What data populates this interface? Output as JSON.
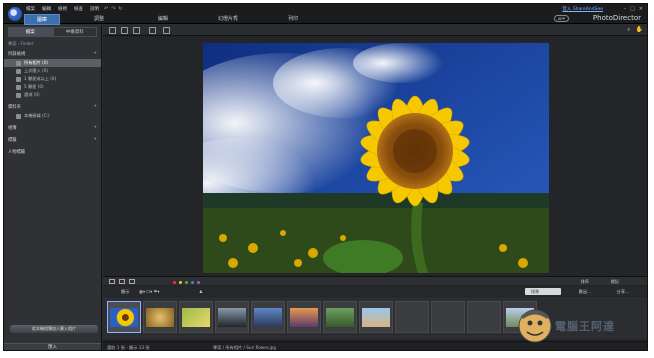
{
  "topbar": {
    "menu": [
      "檔案",
      "編輯",
      "檢視",
      "檢查",
      "說明"
    ],
    "main_tabs": [
      "圖庫",
      "調整",
      "編輯",
      "幻燈片秀",
      "列印"
    ],
    "sign_in": "登入 ShareAndSee",
    "app_badge": "APP",
    "brand": "PhotoDirector"
  },
  "left_panel": {
    "tabs": [
      "檔案",
      "中繼資料"
    ],
    "breadcrumb": "專案 - Finder",
    "section_library": "目錄檢視",
    "library_items": [
      {
        "label": "所有相片 (0)"
      },
      {
        "label": "上次匯入 (0)"
      },
      {
        "label": "1 顆星或以上 (0)"
      },
      {
        "label": "5 顆星 (0)"
      },
      {
        "label": "選項 (0)"
      }
    ],
    "section_folders": "資料夾",
    "folder_item": "本機磁碟 (C:)",
    "section_albums": "相簿",
    "section_tags": "標籤",
    "section_people": "人物標籤",
    "bottom_button": "從本機相簿加入匯入相片",
    "import_button": "匯入"
  },
  "viewer": {
    "photo_alt": "Sunflower"
  },
  "bottombar": {
    "sort_label": "排序",
    "flag_label": "標記"
  },
  "browse_toolbar": {
    "view_label": "顯示",
    "search_placeholder": "搜尋",
    "export_label": "匯出...",
    "share_label": "分享..."
  },
  "status": {
    "selected": "選取 1 張 - 顯示 13 張",
    "path": "專案 / 所有相片 / Sun flower.jpg"
  },
  "watermark": "電腦王阿達",
  "colors": {
    "accent": "#3d6fae",
    "sky": "#1a3f93",
    "petal": "#f6c800",
    "link": "#7fb2ff"
  }
}
